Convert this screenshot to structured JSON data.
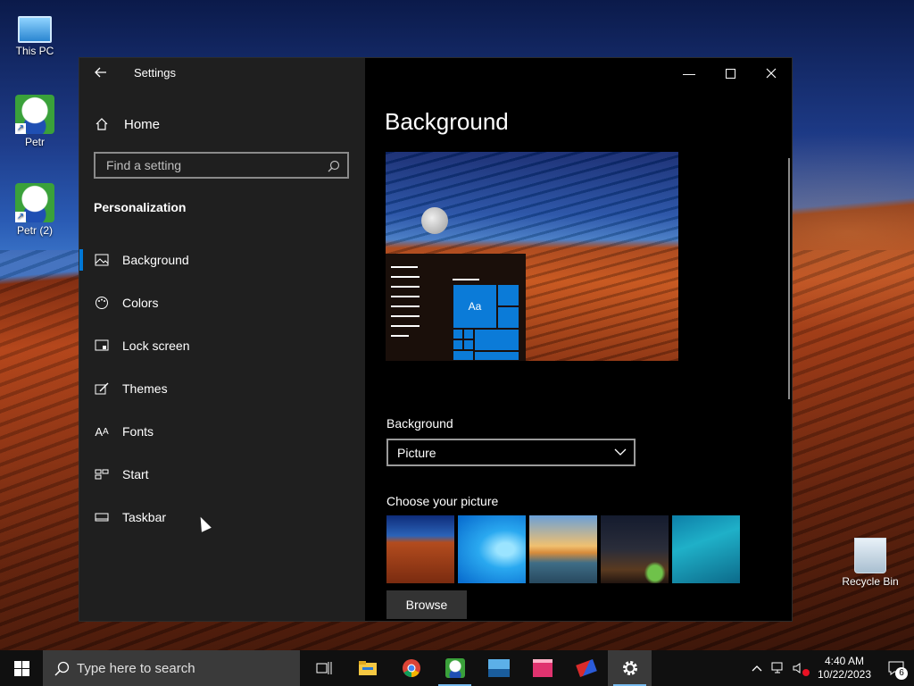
{
  "desktop": {
    "icons": [
      {
        "label": "This PC"
      },
      {
        "label": "Petr"
      },
      {
        "label": "Petr (2)"
      },
      {
        "label": "Recycle Bin"
      }
    ]
  },
  "settings": {
    "window_title": "Settings",
    "home_label": "Home",
    "search_placeholder": "Find a setting",
    "section_heading": "Personalization",
    "nav_items": [
      {
        "label": "Background",
        "icon": "picture-icon",
        "active": true
      },
      {
        "label": "Colors",
        "icon": "palette-icon"
      },
      {
        "label": "Lock screen",
        "icon": "lock-screen-icon"
      },
      {
        "label": "Themes",
        "icon": "brush-icon"
      },
      {
        "label": "Fonts",
        "icon": "fonts-icon"
      },
      {
        "label": "Start",
        "icon": "start-icon"
      },
      {
        "label": "Taskbar",
        "icon": "taskbar-icon"
      }
    ],
    "main": {
      "page_title": "Background",
      "preview_tile_text": "Aa",
      "background_label": "Background",
      "background_value": "Picture",
      "choose_picture_label": "Choose your picture",
      "browse_label": "Browse"
    }
  },
  "taskbar": {
    "search_placeholder": "Type here to search",
    "apps": [
      "task-view-icon",
      "file-explorer-icon",
      "chrome-icon",
      "petr-app-icon",
      "ship-app-icon",
      "store-app-icon",
      "cards-app-icon",
      "settings-icon"
    ],
    "time": "4:40 AM",
    "date": "10/22/2023",
    "notification_count": "6"
  },
  "colors": {
    "accent": "#0078d7",
    "sidebar_bg": "#1f1f1f",
    "main_bg": "#000000",
    "taskbar_bg": "#101010"
  }
}
